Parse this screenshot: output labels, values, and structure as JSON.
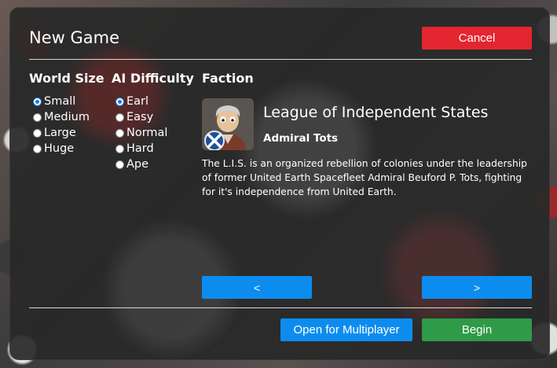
{
  "dialog": {
    "title": "New Game",
    "cancel_label": "Cancel"
  },
  "world_size": {
    "heading": "World Size",
    "options": [
      "Small",
      "Medium",
      "Large",
      "Huge"
    ],
    "selected": "Small"
  },
  "ai_difficulty": {
    "heading": "AI Difficulty",
    "options": [
      "Earl",
      "Easy",
      "Normal",
      "Hard",
      "Ape"
    ],
    "selected": "Earl"
  },
  "faction": {
    "heading": "Faction",
    "name": "League of Independent States",
    "leader": "Admiral Tots",
    "description": "The L.I.S. is an organized rebellion of colonies under the leadership of former United Earth Spacefleet Admiral Beuford P. Tots, fighting for it's independence from United Earth.",
    "prev_label": "<",
    "next_label": ">"
  },
  "footer": {
    "multiplayer_label": "Open for Multiplayer",
    "begin_label": "Begin"
  },
  "colors": {
    "cancel": "#e3262f",
    "primary": "#0d8cf0",
    "begin": "#2f9a47"
  }
}
